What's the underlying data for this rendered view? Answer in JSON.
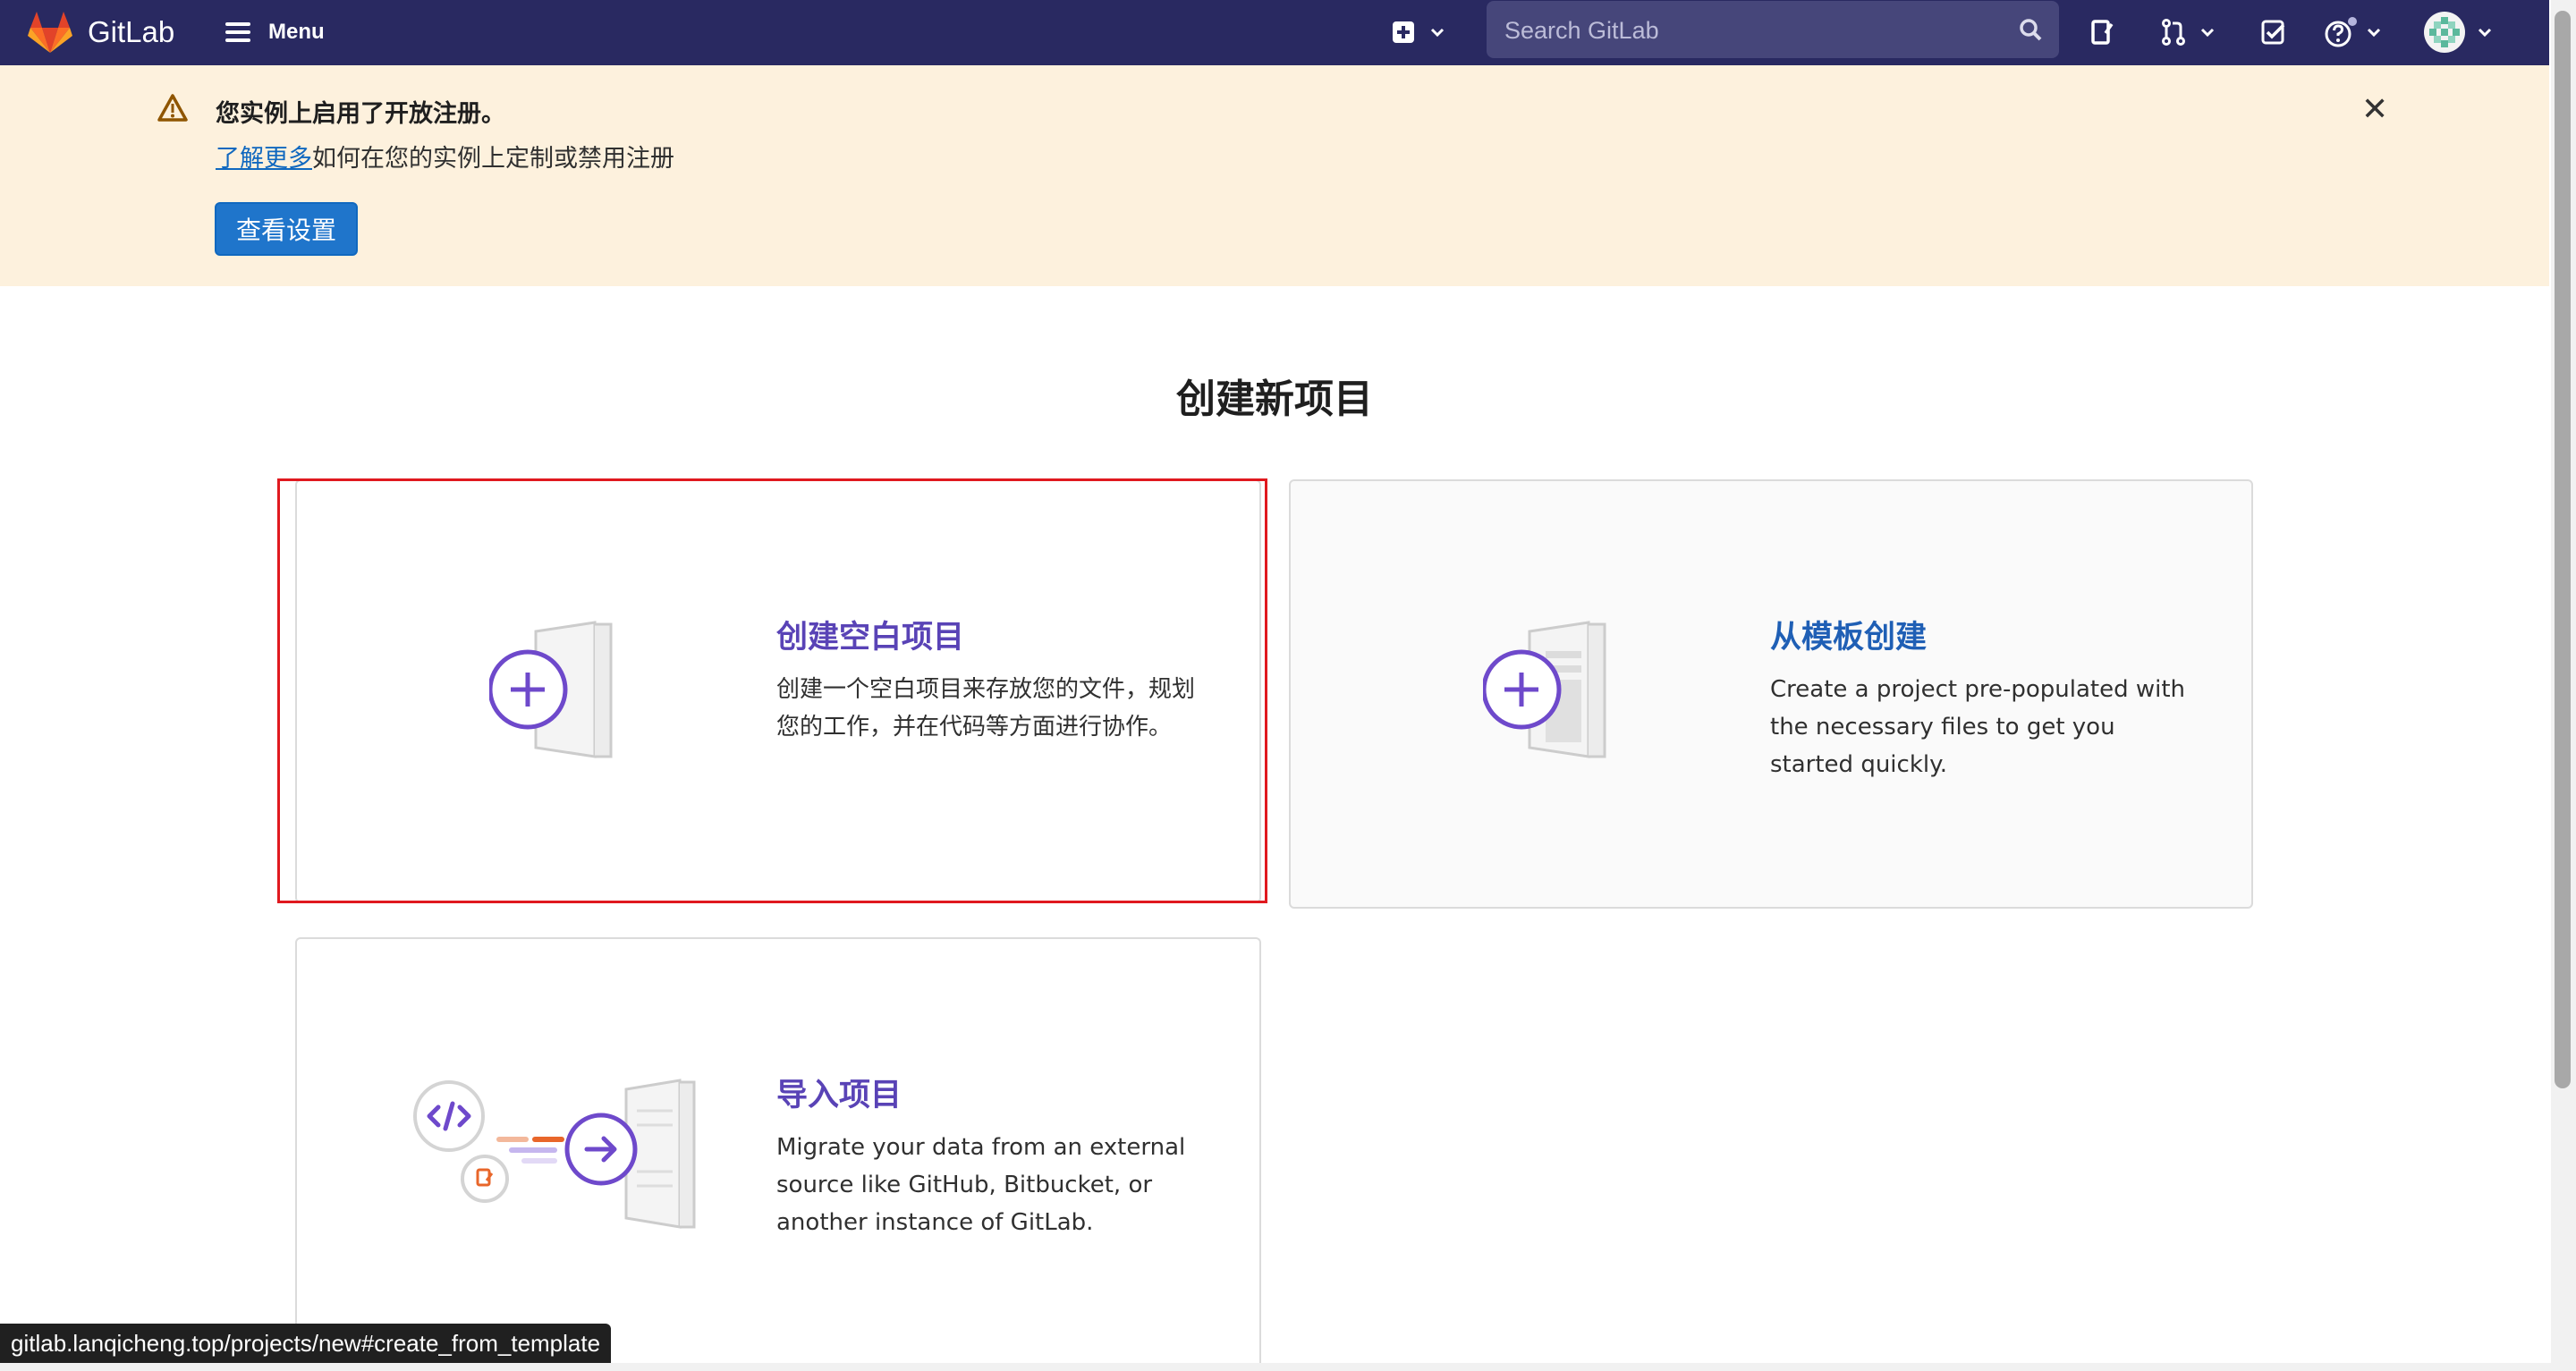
{
  "colors": {
    "navbar_bg": "#292961",
    "banner_bg": "#fdf1dd",
    "primary_button": "#1f75cb",
    "link": "#1068bf",
    "card_title_purple": "#5943b6",
    "card_title_blue": "#1f5fb5",
    "highlight_border": "#e0191f"
  },
  "navbar": {
    "brand": "GitLab",
    "menu_label": "Menu",
    "search": {
      "placeholder": "Search GitLab"
    },
    "icons": [
      "new-item-icon",
      "chevron-down-icon",
      "search-icon",
      "issues-icon",
      "merge-requests-icon",
      "todos-icon",
      "help-icon",
      "avatar"
    ]
  },
  "banner": {
    "title": "您实例上启用了开放注册。",
    "link_text": "了解更多",
    "text_rest": "如何在您的实例上定制或禁用注册",
    "button_label": "查看设置",
    "close": "✕"
  },
  "page": {
    "title": "创建新项目"
  },
  "cards": [
    {
      "title": "创建空白项目",
      "description": "创建一个空白项目来存放您的文件，规划您的工作，并在代码等方面进行协作。",
      "icon": "blank-project-icon",
      "highlighted": true
    },
    {
      "title": "从模板创建",
      "description": "Create a project pre-populated with the necessary files to get you started quickly.",
      "icon": "template-project-icon",
      "highlighted": false
    },
    {
      "title": "导入项目",
      "description": "Migrate your data from an external source like GitHub, Bitbucket, or another instance of GitLab.",
      "icon": "import-project-icon",
      "highlighted": false
    }
  ],
  "status_bar": {
    "url": "gitlab.lanqicheng.top/projects/new#create_from_template"
  }
}
